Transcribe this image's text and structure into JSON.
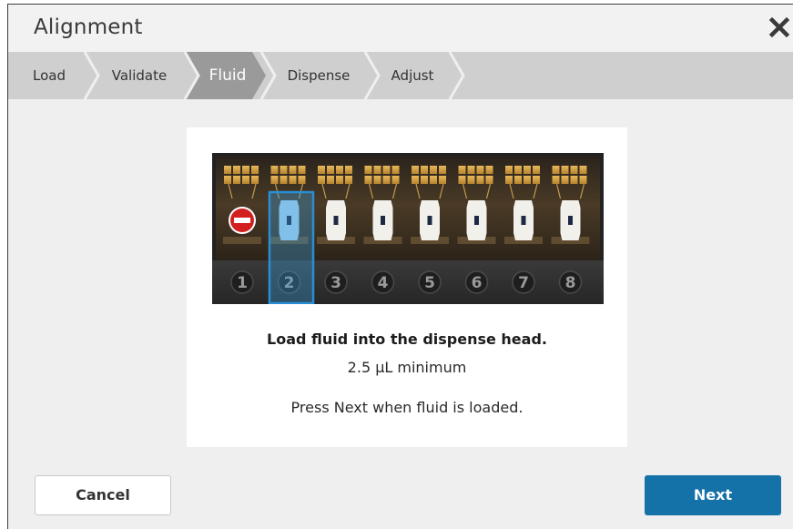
{
  "dialog": {
    "title": "Alignment",
    "close_icon": "close-icon"
  },
  "steps": [
    {
      "label": "Load",
      "active": false
    },
    {
      "label": "Validate",
      "active": false
    },
    {
      "label": "Fluid",
      "active": true
    },
    {
      "label": "Dispense",
      "active": false
    },
    {
      "label": "Adjust",
      "active": false
    }
  ],
  "dispense_head": {
    "channels": [
      "1",
      "2",
      "3",
      "4",
      "5",
      "6",
      "7",
      "8"
    ],
    "disabled_channel": "1",
    "selected_channel": "2"
  },
  "instructions": {
    "main": "Load fluid into the dispense head.",
    "minimum": "2.5 µL minimum",
    "press": "Press Next when fluid is loaded."
  },
  "buttons": {
    "cancel": "Cancel",
    "next": "Next"
  },
  "colors": {
    "accent": "#1572a8",
    "active_step": "#9a9a9a",
    "step_bar": "#cfcfcf",
    "highlight": "#3aa0e0"
  }
}
